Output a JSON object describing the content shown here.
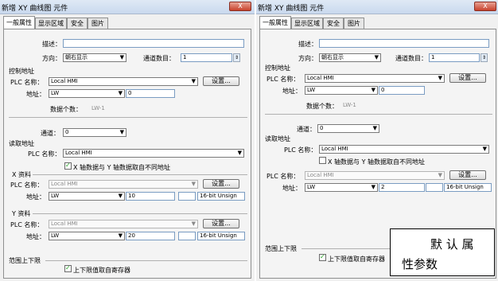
{
  "left": {
    "title": "新增 XY 曲线图 元件",
    "close": "X",
    "tabs": [
      "一般属性",
      "显示区域",
      "安全",
      "图片"
    ],
    "desc_label": "描述：",
    "dir_label": "方向：",
    "dir_value": "朝右显示",
    "chcount_label": "通道数目：",
    "chcount_value": "1",
    "ctrl_title": "控制地址",
    "plc_label": "PLC 名称：",
    "ctrl_plc": "Local HMI",
    "settings": "设置...",
    "addr_label": "地址：",
    "ctrl_addr_type": "LW",
    "ctrl_addr_value": "0",
    "dw_label": "数据个数：",
    "dw_value": "LW-1",
    "channel_label": "通道：",
    "channel_value": "0",
    "read_title": "读取地址",
    "read_plc_label": "PLC 名称：",
    "read_plc": "Local HMI",
    "xy_diff": "X 轴数据与 Y 轴数据取自不同地址",
    "x_group": "X 资料",
    "x_plc": "Local HMI",
    "x_addr_type": "LW",
    "x_addr_value": "10",
    "x_fmt": "16-bit Unsign",
    "y_group": "Y 资料",
    "y_plc": "Local HMI",
    "y_addr_type": "LW",
    "y_addr_value": "20",
    "y_fmt": "16-bit Unsign",
    "range_title": "范围上下限",
    "range_chk": "上下限值取自寄存器"
  },
  "right": {
    "title": "新增 XY 曲线图 元件",
    "close": "X",
    "tabs": [
      "一般属性",
      "显示区域",
      "安全",
      "图片"
    ],
    "desc_label": "描述：",
    "dir_label": "方向：",
    "dir_value": "朝右显示",
    "chcount_label": "通道数目：",
    "chcount_value": "1",
    "ctrl_title": "控制地址",
    "plc_label": "PLC 名称：",
    "ctrl_plc": "Local HMI",
    "settings": "设置...",
    "addr_label": "地址：",
    "ctrl_addr_type": "LW",
    "ctrl_addr_value": "0",
    "dw_label": "数据个数：",
    "dw_value": "LW-1",
    "channel_label": "通道：",
    "channel_value": "0",
    "read_title": "读取地址",
    "read_plc_label": "PLC 名称：",
    "read_plc": "Local HMI",
    "xy_diff": "X 轴数据与 Y 轴数据取自不同地址",
    "plc2_plc": "Local HMI",
    "addr2_type": "LW",
    "addr2_value": "2",
    "fmt2": "16-bit Unsign",
    "range_title": "范围上下限",
    "range_chk": "上下限值取自寄存器"
  },
  "note": {
    "line1": "默 认 属",
    "line2": "性参数"
  }
}
